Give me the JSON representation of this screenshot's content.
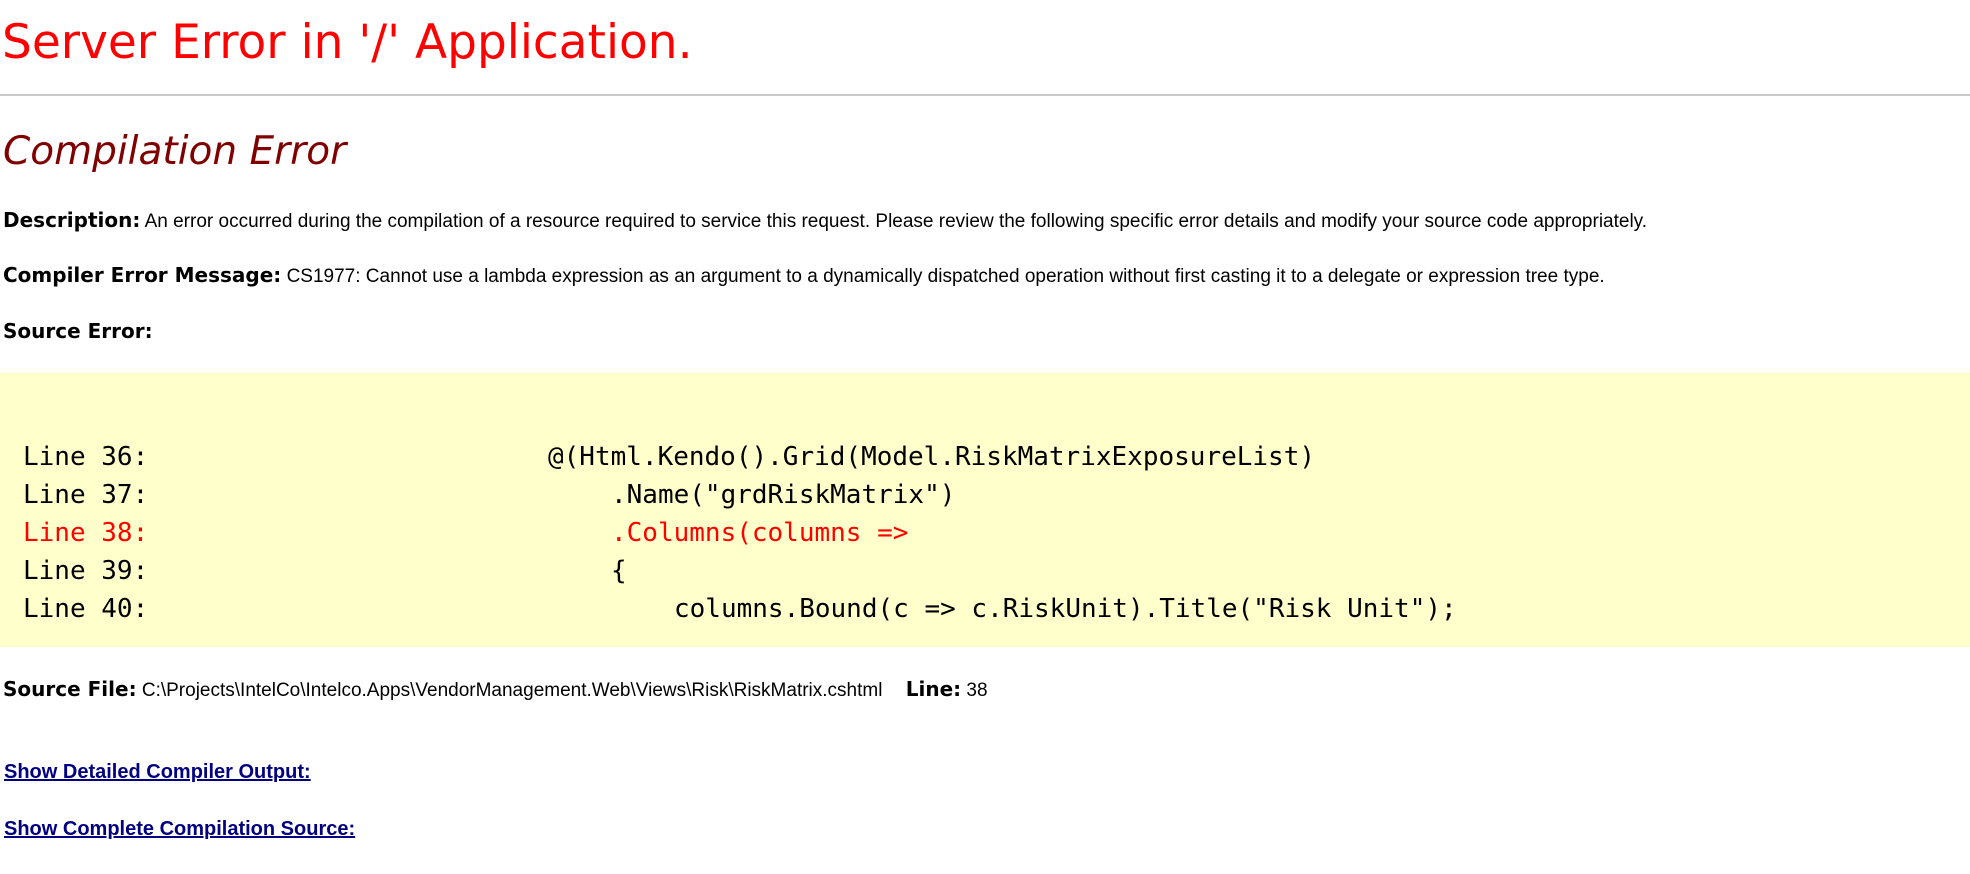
{
  "page": {
    "title": "Server Error in '/' Application.",
    "error_heading": "Compilation Error"
  },
  "description": {
    "label": "Description:",
    "text": "An error occurred during the compilation of a resource required to service this request. Please review the following specific error details and modify your source code appropriately."
  },
  "compiler_error": {
    "label": "Compiler Error Message:",
    "text": "CS1977: Cannot use a lambda expression as an argument to a dynamically dispatched operation without first casting it to a delegate or expression tree type."
  },
  "source_error": {
    "label": "Source Error:"
  },
  "code": {
    "highlight_color": "#ff0000",
    "background_color": "#ffffcc",
    "lines": [
      {
        "label": "Line 36:",
        "text": "@(Html.Kendo().Grid(Model.RiskMatrixExposureList)",
        "highlight": false
      },
      {
        "label": "Line 37:",
        "text": ".Name(\"grdRiskMatrix\")",
        "highlight": false
      },
      {
        "label": "Line 38:",
        "text": ".Columns(columns =>",
        "highlight": true
      },
      {
        "label": "Line 39:",
        "text": "{",
        "highlight": false
      },
      {
        "label": "Line 40:",
        "text": "columns.Bound(c => c.RiskUnit).Title(\"Risk Unit\");",
        "highlight": false
      }
    ]
  },
  "source_file": {
    "label": "Source File:",
    "path": "C:\\Projects\\IntelCo\\Intelco.Apps\\VendorManagement.Web\\Views\\Risk\\RiskMatrix.cshtml",
    "line_label": "Line:",
    "line_value": "38"
  },
  "links": {
    "detailed_output": "Show Detailed Compiler Output:",
    "complete_source": "Show Complete Compilation Source:"
  },
  "colors": {
    "title": "#ff0000",
    "error_heading": "#800000",
    "link": "#000080"
  }
}
